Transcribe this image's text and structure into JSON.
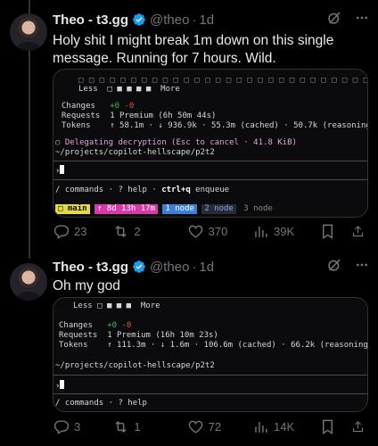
{
  "tweets": [
    {
      "author_name": "Theo - t3.gg",
      "handle": "@theo",
      "time": "1d",
      "text": "Holy shit I might break 1m down on this single message. Running for 7 hours. Wild.",
      "terminal": {
        "squares_row": "□ □ □ □ □ □ □ □ □ □ □ □ □ □ □ □ □ □ □ □ □ □ □ □ □ □ □ □ □ □ □ □ □ □ □ □",
        "less_label": "Less",
        "meter": "□ ■ ■ ■ ■",
        "more_label": "More",
        "changes_label": "Changes",
        "changes_plus": "+0",
        "changes_minus": "-0",
        "requests_label": "Requests",
        "requests_value": "1 Premium (6h 50m 44s)",
        "tokens_label": "Tokens",
        "tokens_value": "↑ 58.1m · ↓ 936.9k · 55.3m (cached) · 50.7k (reasoning)",
        "status": "○ Delegating decryption (Esc to cancel · 41.8 KiB)",
        "path": "~/projects/copilot-hellscape/p2t2",
        "prompt": "›",
        "footer_commands": "/ commands",
        "footer_help": "? help",
        "footer_key": "ctrl+q",
        "footer_enqueue": "enqueue",
        "badge_main": "□ main",
        "badge_time": "↑ 8d 13h 17m",
        "badge_node1": "1 node",
        "badge_node2": "2 node",
        "badge_node3": "3 node"
      },
      "replies": "23",
      "retweets": "2",
      "likes": "370",
      "views": "39K"
    },
    {
      "author_name": "Theo - t3.gg",
      "handle": "@theo",
      "time": "1d",
      "text": "Oh my god",
      "terminal": {
        "less_label": "Less",
        "meter": "□ ■ ■ ■",
        "more_label": "More",
        "changes_label": "Changes",
        "changes_plus": "+0",
        "changes_minus": "-0",
        "requests_label": "Requests",
        "requests_value": "1 Premium (16h 10m 23s)",
        "tokens_label": "Tokens",
        "tokens_value": "↑ 111.3m · ↓ 1.6m · 106.6m (cached) · 66.2k (reasoning)",
        "path": "~/projects/copilot-hellscape/p2t2",
        "prompt": "›",
        "footer_commands": "/ commands",
        "footer_help": "? help"
      },
      "replies": "3",
      "retweets": "1",
      "likes": "72",
      "views": "14K"
    }
  ],
  "colors": {
    "background": "#000000",
    "text": "#e7e9ea",
    "muted": "#71767b",
    "verified": "#1d9bf0"
  },
  "icons": [
    "verified-badge-icon",
    "grok-icon",
    "more-icon",
    "reply-icon",
    "retweet-icon",
    "like-icon",
    "views-icon",
    "bookmark-icon",
    "share-icon"
  ]
}
